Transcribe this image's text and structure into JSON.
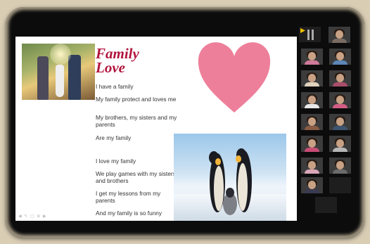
{
  "slide": {
    "title_line1": "Family",
    "title_line2": "Love",
    "lines": [
      "I have a family",
      "My family protect and loves me",
      "My brothers, my sisters and my parents",
      "Are my family",
      "I love my family",
      "We play games with my sisters and brothers",
      "I get my lessons from my parents",
      "And my family is so funny"
    ]
  },
  "gallery": {
    "participant_label_1": "",
    "participant_label_2": "",
    "dark_tile_name": "",
    "bottom_tile_name": ""
  },
  "colors": {
    "title": "#b1153d",
    "heart": "#ee7f9a",
    "frame": "#0c0c0c"
  }
}
